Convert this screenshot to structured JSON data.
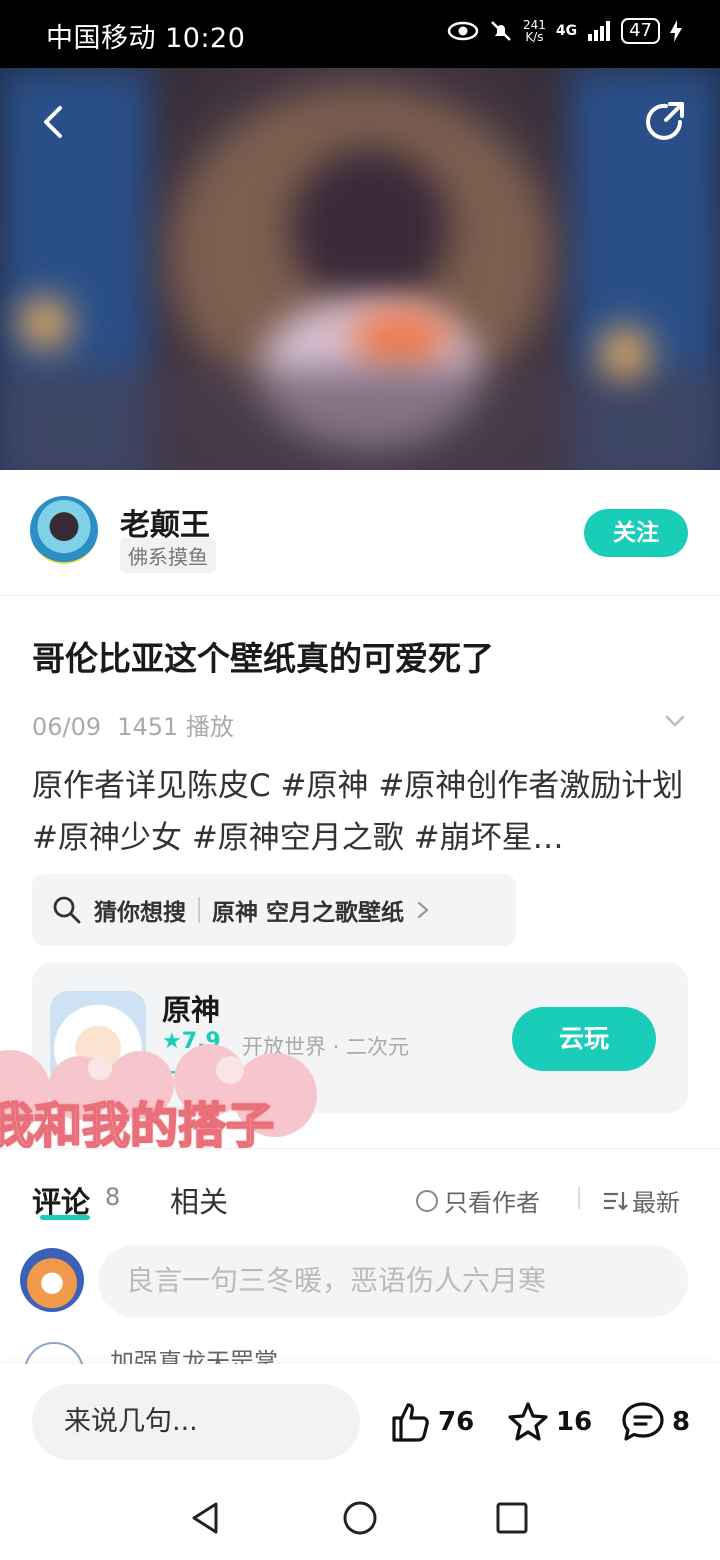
{
  "status_bar": {
    "carrier_time": "中国移动 10:20",
    "speed_top": "241",
    "speed_bottom": "K/s",
    "network": "4G",
    "battery": "47"
  },
  "post": {
    "author_name": "老颠王",
    "author_tag": "佛系摸鱼",
    "follow_label": "关注",
    "title": "哥伦比亚这个壁纸真的可爱死了",
    "date": "06/09",
    "plays": "1451 播放",
    "description": "原作者详见陈皮C #原神 #原神创作者激励计划 #原神少女 #原神空月之歌 #崩坏星…",
    "search_prefix": "猜你想搜",
    "search_term": "原神 空月之歌壁纸"
  },
  "game_card": {
    "name": "原神",
    "rating": "7.9",
    "tags": "开放世界 · 二次元",
    "forum_label": "前往论坛",
    "cloud_play_label": "云玩"
  },
  "overlay_text": "我和我的搭子",
  "comments": {
    "tab_comment": "评论",
    "tab_comment_count": "8",
    "tab_related": "相关",
    "only_author": "只看作者",
    "sort_latest": "最新",
    "input_placeholder": "良言一句三冬暖，恶语伤人六月寒",
    "peek_name": "加强真龙天罡掌"
  },
  "bottom_bar": {
    "say_placeholder": "来说几句...",
    "likes": "76",
    "favorites": "16",
    "comments": "8"
  },
  "colors": {
    "accent": "#19cdb8",
    "overlay_stroke": "#e9707a"
  }
}
